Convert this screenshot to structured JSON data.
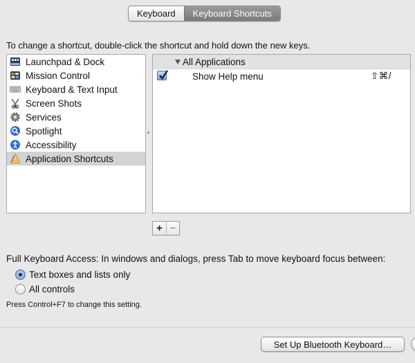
{
  "tabs": [
    {
      "label": "Keyboard",
      "active": false
    },
    {
      "label": "Keyboard Shortcuts",
      "active": true
    }
  ],
  "instruction": "To change a shortcut, double-click the shortcut and hold down the new keys.",
  "categories": [
    {
      "label": "Launchpad & Dock",
      "icon": "launchpad-dock-icon"
    },
    {
      "label": "Mission Control",
      "icon": "mission-control-icon"
    },
    {
      "label": "Keyboard & Text Input",
      "icon": "keyboard-icon"
    },
    {
      "label": "Screen Shots",
      "icon": "screenshot-icon"
    },
    {
      "label": "Services",
      "icon": "services-gear-icon"
    },
    {
      "label": "Spotlight",
      "icon": "spotlight-icon"
    },
    {
      "label": "Accessibility",
      "icon": "accessibility-icon"
    },
    {
      "label": "Application Shortcuts",
      "icon": "app-shortcuts-icon",
      "selected": true
    }
  ],
  "shortcuts": {
    "group_label": "All Applications",
    "items": [
      {
        "name": "Show Help menu",
        "keys": "⇧⌘/",
        "enabled": true
      }
    ]
  },
  "buttons": {
    "add": "+",
    "remove": "−",
    "bluetooth": "Set Up Bluetooth Keyboard…"
  },
  "full_keyboard_access": {
    "label": "Full Keyboard Access: In windows and dialogs, press Tab to move keyboard focus between:",
    "options": [
      {
        "label": "Text boxes and lists only",
        "selected": true
      },
      {
        "label": "All controls",
        "selected": false
      }
    ],
    "hint": "Press Control+F7 to change this setting."
  }
}
